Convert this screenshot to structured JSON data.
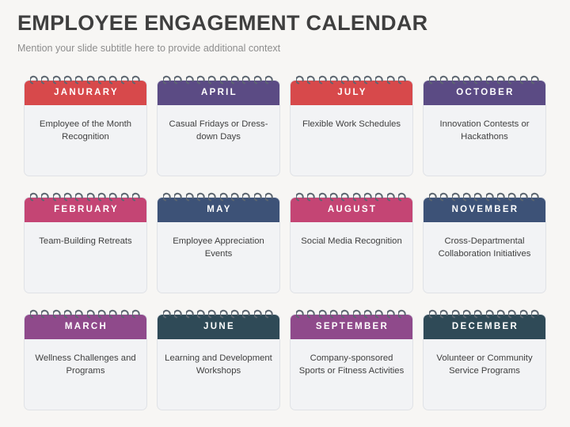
{
  "header": {
    "title": "EMPLOYEE ENGAGEMENT CALENDAR",
    "subtitle": "Mention your slide subtitle here to provide additional context"
  },
  "colors": {
    "background": "#f7f6f4",
    "title_text": "#3f3f3f",
    "subtitle_text": "#8d8d8d",
    "card_body": "#f2f3f5",
    "card_border": "#e0e2e6",
    "ring": "#5c6670",
    "red": "#d7494b",
    "purple": "#5b4b84",
    "pink": "#c44574",
    "navy": "#3d5277",
    "orchid": "#8f4a8b",
    "teal": "#2f4a57"
  },
  "calendar": {
    "ring_count": 10,
    "cards": [
      {
        "month": "JANURARY",
        "activity": "Employee of the Month Recognition",
        "color": "#d7494b"
      },
      {
        "month": "APRIL",
        "activity": "Casual Fridays or Dress-down Days",
        "color": "#5b4b84"
      },
      {
        "month": "JULY",
        "activity": "Flexible Work Schedules",
        "color": "#d7494b"
      },
      {
        "month": "OCTOBER",
        "activity": "Innovation Contests or Hackathons",
        "color": "#5b4b84"
      },
      {
        "month": "FEBRUARY",
        "activity": "Team-Building Retreats",
        "color": "#c44574"
      },
      {
        "month": "MAY",
        "activity": "Employee Appreciation Events",
        "color": "#3d5277"
      },
      {
        "month": "AUGUST",
        "activity": "Social Media Recognition",
        "color": "#c44574"
      },
      {
        "month": "NOVEMBER",
        "activity": "Cross-Departmental Collaboration Initiatives",
        "color": "#3d5277"
      },
      {
        "month": "MARCH",
        "activity": "Wellness Challenges and Programs",
        "color": "#8f4a8b"
      },
      {
        "month": "JUNE",
        "activity": "Learning and Development Workshops",
        "color": "#2f4a57"
      },
      {
        "month": "SEPTEMBER",
        "activity": "Company-sponsored Sports or Fitness Activities",
        "color": "#8f4a8b"
      },
      {
        "month": "DECEMBER",
        "activity": "Volunteer or Community Service Programs",
        "color": "#2f4a57"
      }
    ]
  }
}
